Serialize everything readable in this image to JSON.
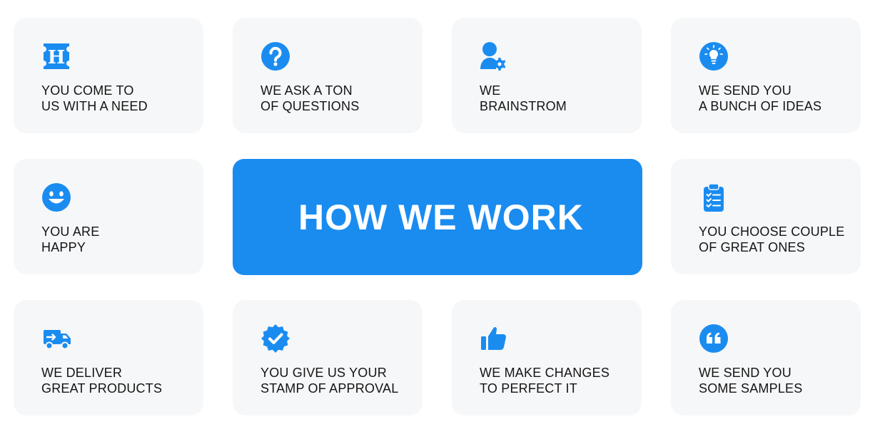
{
  "center_title": "HOW WE WORK",
  "accent_color": "#1a8cf0",
  "cards": [
    {
      "icon": "h-logo-icon",
      "line1": "YOU COME TO",
      "line2": "US WITH A NEED"
    },
    {
      "icon": "question-icon",
      "line1": "WE ASK A TON",
      "line2": "OF QUESTIONS"
    },
    {
      "icon": "user-gear-icon",
      "line1": "WE",
      "line2": "BRAINSTROM"
    },
    {
      "icon": "lightbulb-icon",
      "line1": "WE SEND YOU",
      "line2": "A BUNCH OF IDEAS"
    },
    {
      "icon": "smiley-icon",
      "line1": "YOU ARE",
      "line2": "HAPPY"
    },
    {
      "icon": "clipboard-check-icon",
      "line1": "YOU CHOOSE COUPLE",
      "line2": "OF GREAT ONES"
    },
    {
      "icon": "delivery-truck-icon",
      "line1": "WE DELIVER",
      "line2": "GREAT PRODUCTS"
    },
    {
      "icon": "verified-badge-icon",
      "line1": "YOU GIVE US YOUR",
      "line2": "STAMP OF APPROVAL"
    },
    {
      "icon": "thumbs-up-icon",
      "line1": "WE MAKE CHANGES",
      "line2": "TO PERFECT IT"
    },
    {
      "icon": "quote-icon",
      "line1": "WE SEND YOU",
      "line2": "SOME SAMPLES"
    }
  ]
}
